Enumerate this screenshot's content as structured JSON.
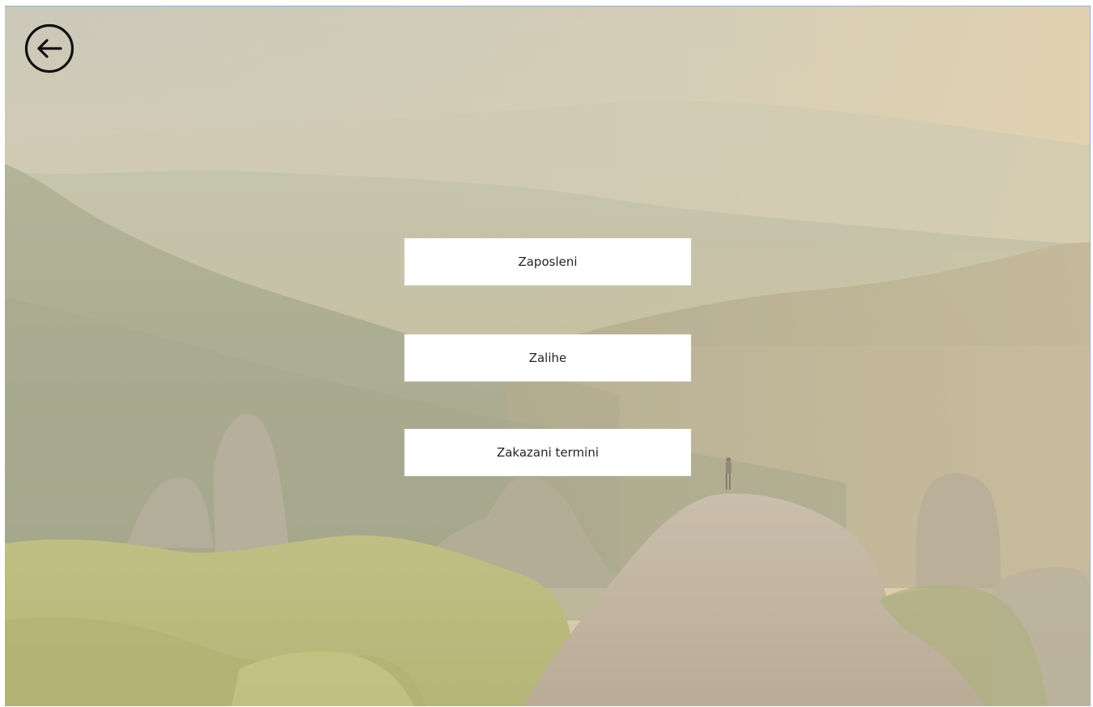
{
  "window": {
    "border_color": "#8fb3d6"
  },
  "back_button": {
    "icon": "arrow-left-circle-icon"
  },
  "menu": {
    "items": [
      {
        "label": "Zaposleni"
      },
      {
        "label": "Zalihe"
      },
      {
        "label": "Zakazani termini"
      }
    ]
  },
  "colors": {
    "button_bg": "#ffffff",
    "button_text": "#1f2328",
    "sky_top": "#c7c8b8",
    "haze": "#d8ccb1",
    "forest": "#9b9b78",
    "grass": "#b6b86d",
    "rock": "#b8ae9d"
  }
}
